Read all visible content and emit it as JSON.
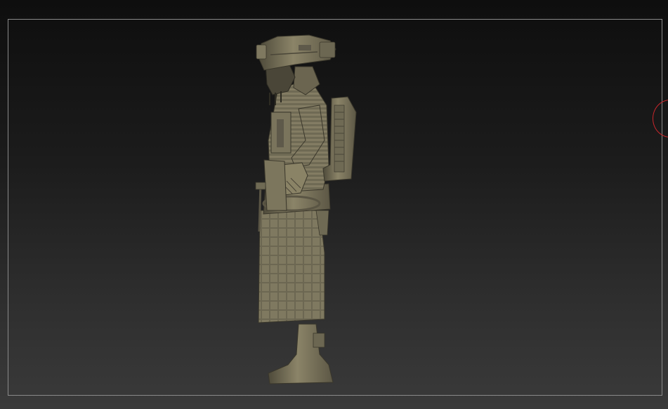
{
  "viewport": {
    "background_top": "#0e0e0e",
    "background_bottom": "#3a3a3a",
    "frame_color": "#8a8a8a"
  },
  "model": {
    "icon": "armored-figure-side-view",
    "material_color": "#7f7960"
  },
  "gizmo": {
    "icon": "rotation-gizmo-ring",
    "color": "#c8262b"
  }
}
